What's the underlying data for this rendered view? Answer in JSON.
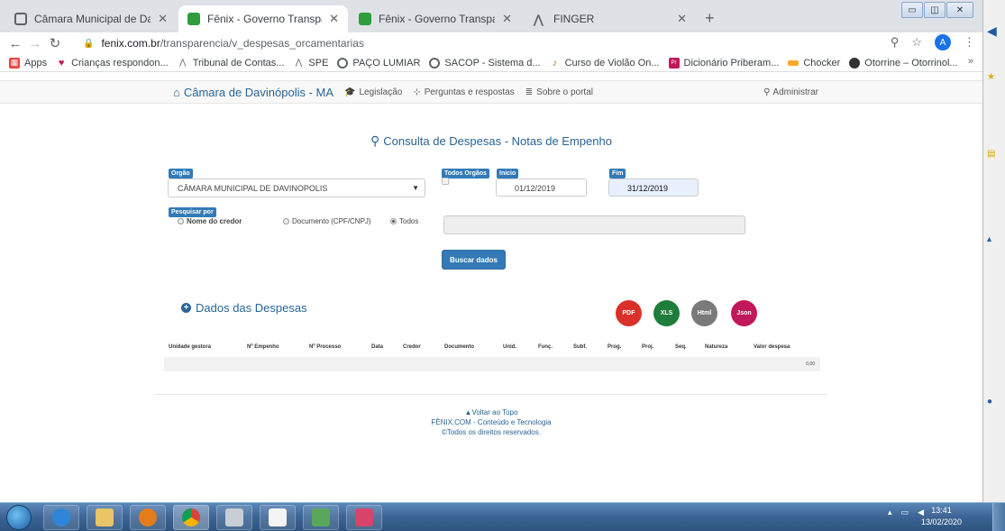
{
  "browser": {
    "tabs": [
      {
        "title": "Câmara Municipal de Davinópoli",
        "icon": "globe-icon",
        "active": false
      },
      {
        "title": "Fênix - Governo Transparente",
        "icon": "fenix-icon",
        "active": true
      },
      {
        "title": "Fênix - Governo Transparente",
        "icon": "fenix-icon",
        "active": false
      },
      {
        "title": "FINGER",
        "icon": "finger-icon",
        "active": false
      }
    ],
    "url_host": "fenix.com.br",
    "url_path": "/transparencia/v_despesas_orcamentarias",
    "avatar_letter": "A",
    "bookmarks": [
      {
        "label": "Apps",
        "icon": "apps-grid-icon",
        "color": "#e8453c"
      },
      {
        "label": "Crianças respondon...",
        "icon": "heart-icon",
        "color": "#c2185b"
      },
      {
        "label": "Tribunal de Contas...",
        "icon": "finger-icon",
        "color": "#5f6368"
      },
      {
        "label": "SPE",
        "icon": "finger-icon",
        "color": "#5f6368"
      },
      {
        "label": "PAÇO LUMIAR",
        "icon": "globe-icon",
        "color": "#5f6368"
      },
      {
        "label": "SACOP - Sistema d...",
        "icon": "globe-icon",
        "color": "#5f6368"
      },
      {
        "label": "Curso de Violão On...",
        "icon": "guitar-icon",
        "color": "#b07a2a"
      },
      {
        "label": "Dicionário Priberam...",
        "icon": "priberam-icon",
        "color": "#c2185b"
      },
      {
        "label": "Chocker",
        "icon": "chocker-icon",
        "color": "#f9a825"
      },
      {
        "label": "Otorrine – Otorrinol...",
        "icon": "otorrine-icon",
        "color": "#333333"
      }
    ]
  },
  "portal": {
    "brand": "Câmara de Davinópolis - MA",
    "nav": [
      {
        "label": "Legislação",
        "icon": "graduation-cap-icon"
      },
      {
        "label": "Perguntas e respostas",
        "icon": "sitemap-icon"
      },
      {
        "label": "Sobre o portal",
        "icon": "list-icon"
      }
    ],
    "admin": "Administrar"
  },
  "form": {
    "title": "Consulta de Despesas - Notas de Empenho",
    "orgao_label": "Orgão",
    "orgao_value": "CÂMARA MUNICIPAL DE DAVINOPOLIS",
    "todos_orgaos_label": "Todos Orgãos",
    "inicio_label": "Inicio",
    "inicio_value": "01/12/2019",
    "fim_label": "Fim",
    "fim_value": "31/12/2019",
    "pesquisar_label": "Pesquisar por",
    "radio_options": [
      {
        "label": "Nome do credor",
        "selected": false
      },
      {
        "label": "Documento (CPF/CNPJ)",
        "selected": false
      },
      {
        "label": "Todos",
        "selected": true
      }
    ],
    "search_button": "Buscar dados"
  },
  "results": {
    "section_title": "Dados das Despesas",
    "export_buttons": [
      {
        "label": "PDF",
        "icon": "pdf-export-icon",
        "color": "#d9302b"
      },
      {
        "label": "XLS",
        "icon": "excel-export-icon",
        "color": "#1e7d3a"
      },
      {
        "label": "Html",
        "icon": "html-export-icon",
        "color": "#7a7a7a"
      },
      {
        "label": "Json",
        "icon": "json-export-icon",
        "color": "#c2185b"
      }
    ],
    "columns": [
      "Unidade gestora",
      "Nº Empenho",
      "Nº Processo",
      "Data",
      "Credor",
      "Documento",
      "Unid.",
      "Funç.",
      "Subf.",
      "Prog.",
      "Proj.",
      "Seq.",
      "Natureza",
      "Valor despesa"
    ],
    "total": "0,00"
  },
  "footer": {
    "back_to_top": "Voltar ao Topo",
    "company": "FÊNIX.COM - Conteúdo e Tecnologia",
    "rights": "©Todos os direitos reservados."
  },
  "taskbar": {
    "time": "13:41",
    "date": "13/02/2020"
  }
}
